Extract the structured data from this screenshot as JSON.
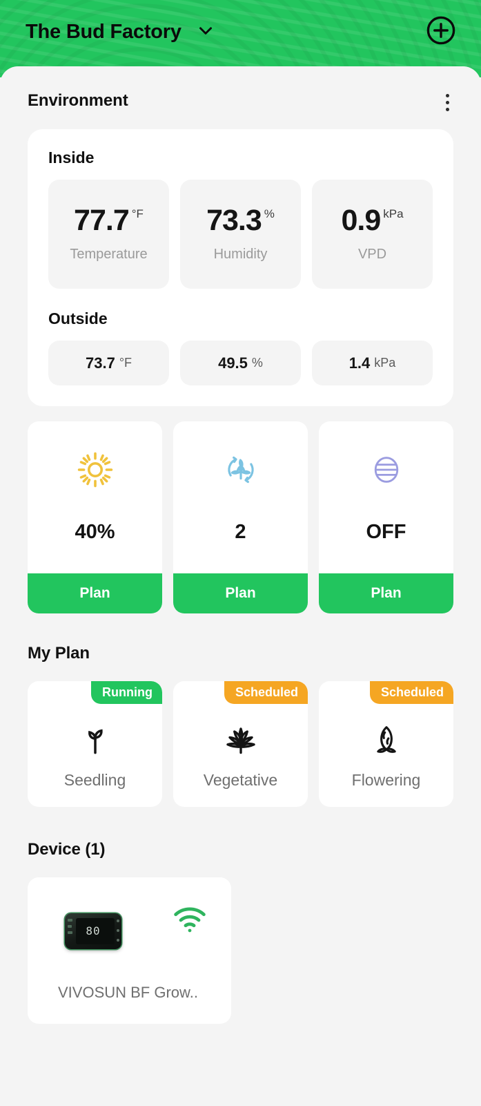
{
  "header": {
    "title": "The Bud Factory",
    "dropdown_icon": "chevron-down-icon",
    "add_icon": "plus-circle-icon",
    "bg_color": "#22c55e"
  },
  "environment": {
    "title": "Environment",
    "menu_icon": "kebab-menu-icon",
    "inside": {
      "label": "Inside",
      "metrics": [
        {
          "value": "77.7",
          "unit": "°F",
          "name": "Temperature"
        },
        {
          "value": "73.3",
          "unit": "%",
          "name": "Humidity"
        },
        {
          "value": "0.9",
          "unit": "kPa",
          "name": "VPD"
        }
      ]
    },
    "outside": {
      "label": "Outside",
      "metrics": [
        {
          "value": "73.7",
          "unit": "°F"
        },
        {
          "value": "49.5",
          "unit": "%"
        },
        {
          "value": "1.4",
          "unit": "kPa"
        }
      ]
    }
  },
  "controls": [
    {
      "icon": "sun-icon",
      "icon_color": "#f0c23c",
      "value": "40%",
      "action": "Plan"
    },
    {
      "icon": "air-circulation-leaf-icon",
      "icon_color": "#7cc3e2",
      "value": "2",
      "action": "Plan"
    },
    {
      "icon": "humidifier-icon",
      "icon_color": "#9b9ce0",
      "value": "OFF",
      "action": "Plan"
    }
  ],
  "my_plan": {
    "title": "My Plan",
    "cards": [
      {
        "badge": "Running",
        "badge_color": "#22c55e",
        "icon": "sprout-icon",
        "name": "Seedling"
      },
      {
        "badge": "Scheduled",
        "badge_color": "#f5a623",
        "icon": "cannabis-leaf-icon",
        "name": "Vegetative"
      },
      {
        "badge": "Scheduled",
        "badge_color": "#f5a623",
        "icon": "bud-flower-icon",
        "name": "Flowering"
      }
    ]
  },
  "device": {
    "title": "Device (1)",
    "items": [
      {
        "name": "VIVOSUN BF Grow..",
        "display_value": "80",
        "wifi_icon": "wifi-icon",
        "wifi_color": "#2fb45e"
      }
    ]
  }
}
